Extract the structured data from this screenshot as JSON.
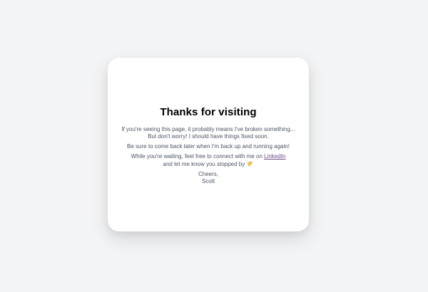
{
  "card": {
    "title": "Thanks for visiting",
    "paragraph1": "If you're seeing this page, it probably means I've broken something... But don't worry! I should have things fixed soon.",
    "paragraph2": "Be sure to come back later when I'm back up and running again!",
    "paragraph3_before": "While you're waiting, feel free to connect with me on ",
    "linkedin_link": "LinkedIn",
    "paragraph3_after": "and let me know you stopped by",
    "wave_icon": "waving-hand-icon",
    "signoff_line1": "Cheers,",
    "signoff_line2": "Scott"
  },
  "colors": {
    "background": "#f3f4f6",
    "card": "#ffffff",
    "title": "#000000",
    "body_text": "#4b5563",
    "link": "#6d4a8a"
  }
}
